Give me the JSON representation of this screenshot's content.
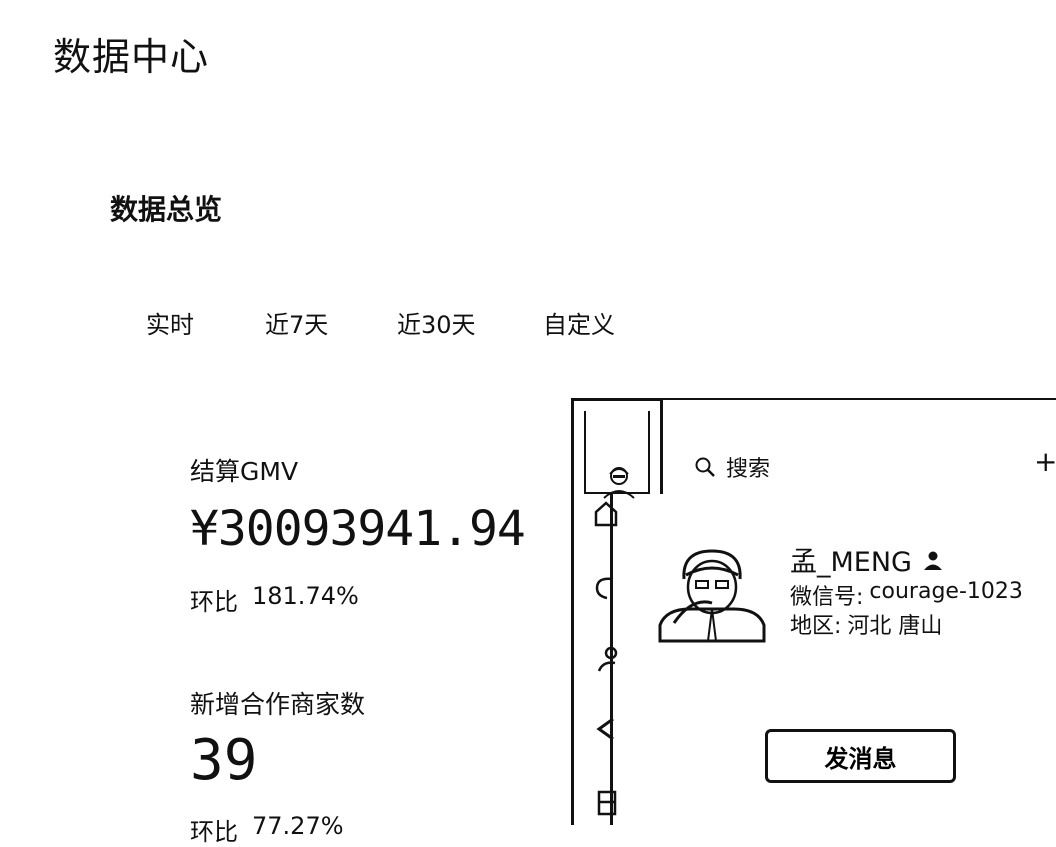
{
  "header": {
    "title": "数据中心"
  },
  "overview": {
    "title": "数据总览",
    "tabs": [
      {
        "label": "实时"
      },
      {
        "label": "近7天"
      },
      {
        "label": "近30天"
      },
      {
        "label": "自定义"
      }
    ]
  },
  "metrics": [
    {
      "label": "结算GMV",
      "value": "¥30093941.94",
      "compare_label": "环比",
      "compare_value": "181.74%"
    },
    {
      "label": "新增合作商家数",
      "value": "39",
      "compare_label": "环比",
      "compare_value": "77.27%"
    }
  ],
  "contact_card": {
    "search_placeholder": "搜索",
    "add_symbol": "+",
    "name": "孟_MENG",
    "wechat_label": "微信号:",
    "wechat_id": "courage-1023",
    "region_label": "地区:",
    "region_value": "河北 唐山",
    "send_button": "发消息"
  },
  "icons": {
    "search": "search-icon",
    "add": "plus-icon",
    "gender": "person-icon"
  }
}
